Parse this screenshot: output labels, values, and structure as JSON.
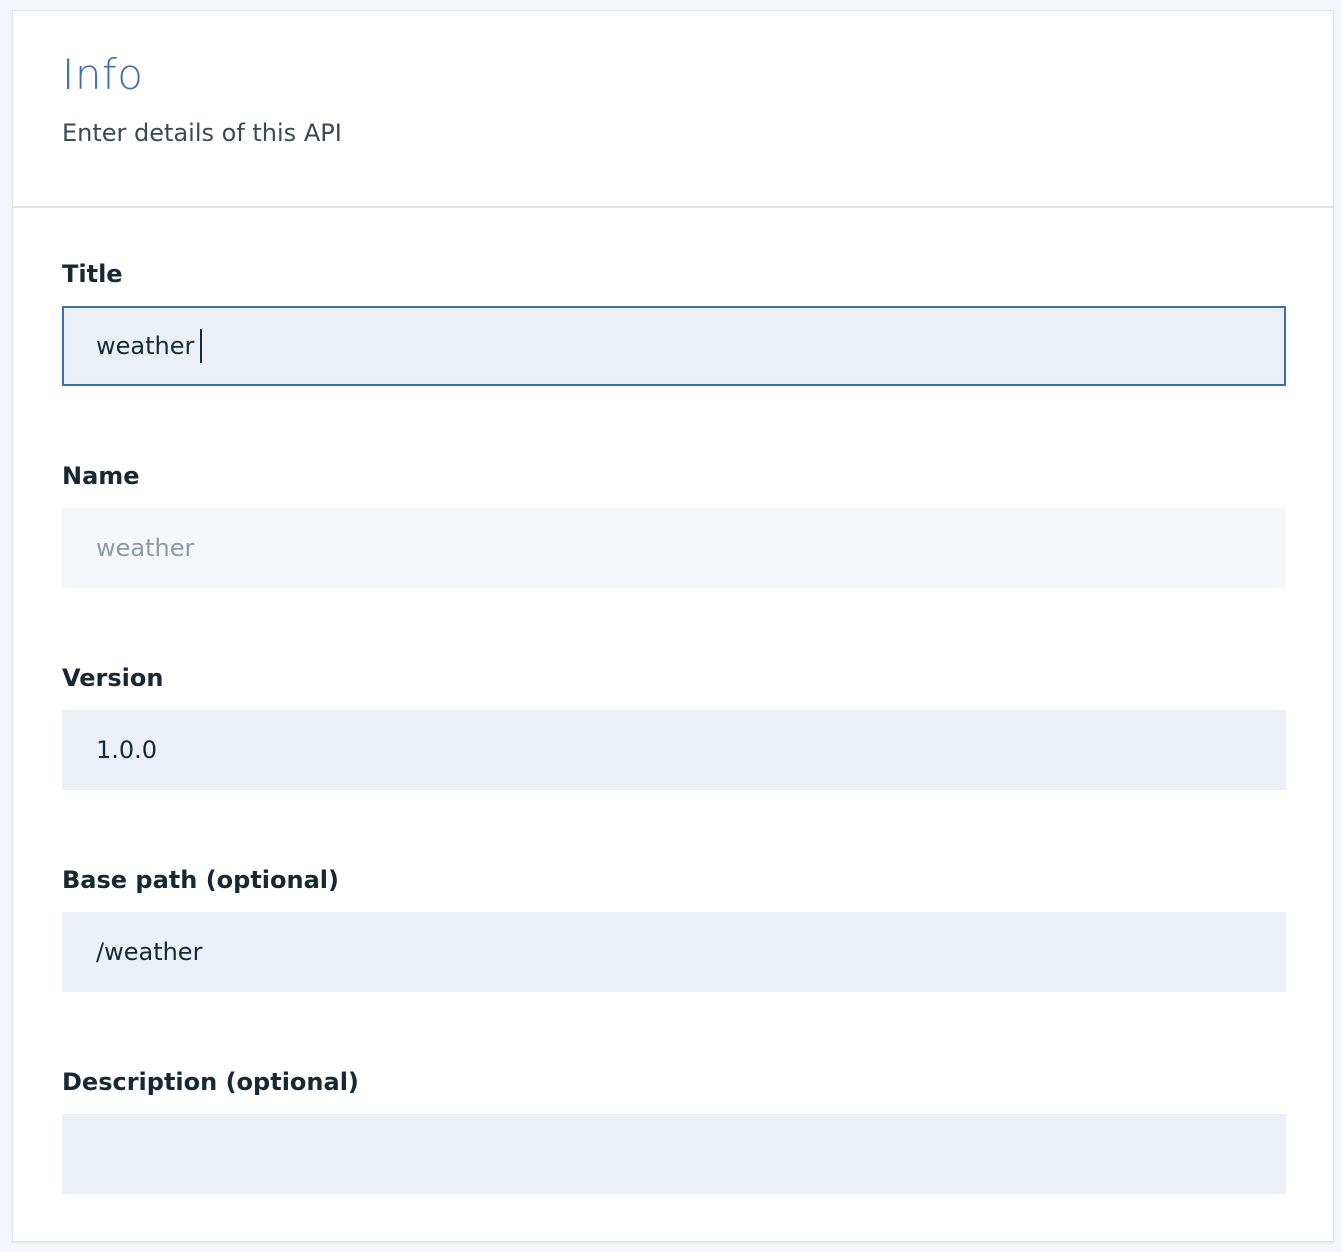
{
  "header": {
    "title": "Info",
    "subtitle": "Enter details of this API"
  },
  "form": {
    "title": {
      "label": "Title",
      "value": "weather"
    },
    "name": {
      "label": "Name",
      "value": "weather"
    },
    "version": {
      "label": "Version",
      "value": "1.0.0"
    },
    "base_path": {
      "label": "Base path (optional)",
      "value": "/weather"
    },
    "description": {
      "label": "Description (optional)",
      "value": ""
    }
  },
  "colors": {
    "accent": "#3d70b2",
    "input_background": "#ebf0f7",
    "disabled_background": "#f5f7fa",
    "label_text": "#152935",
    "disabled_text": "#8c9ba5"
  }
}
